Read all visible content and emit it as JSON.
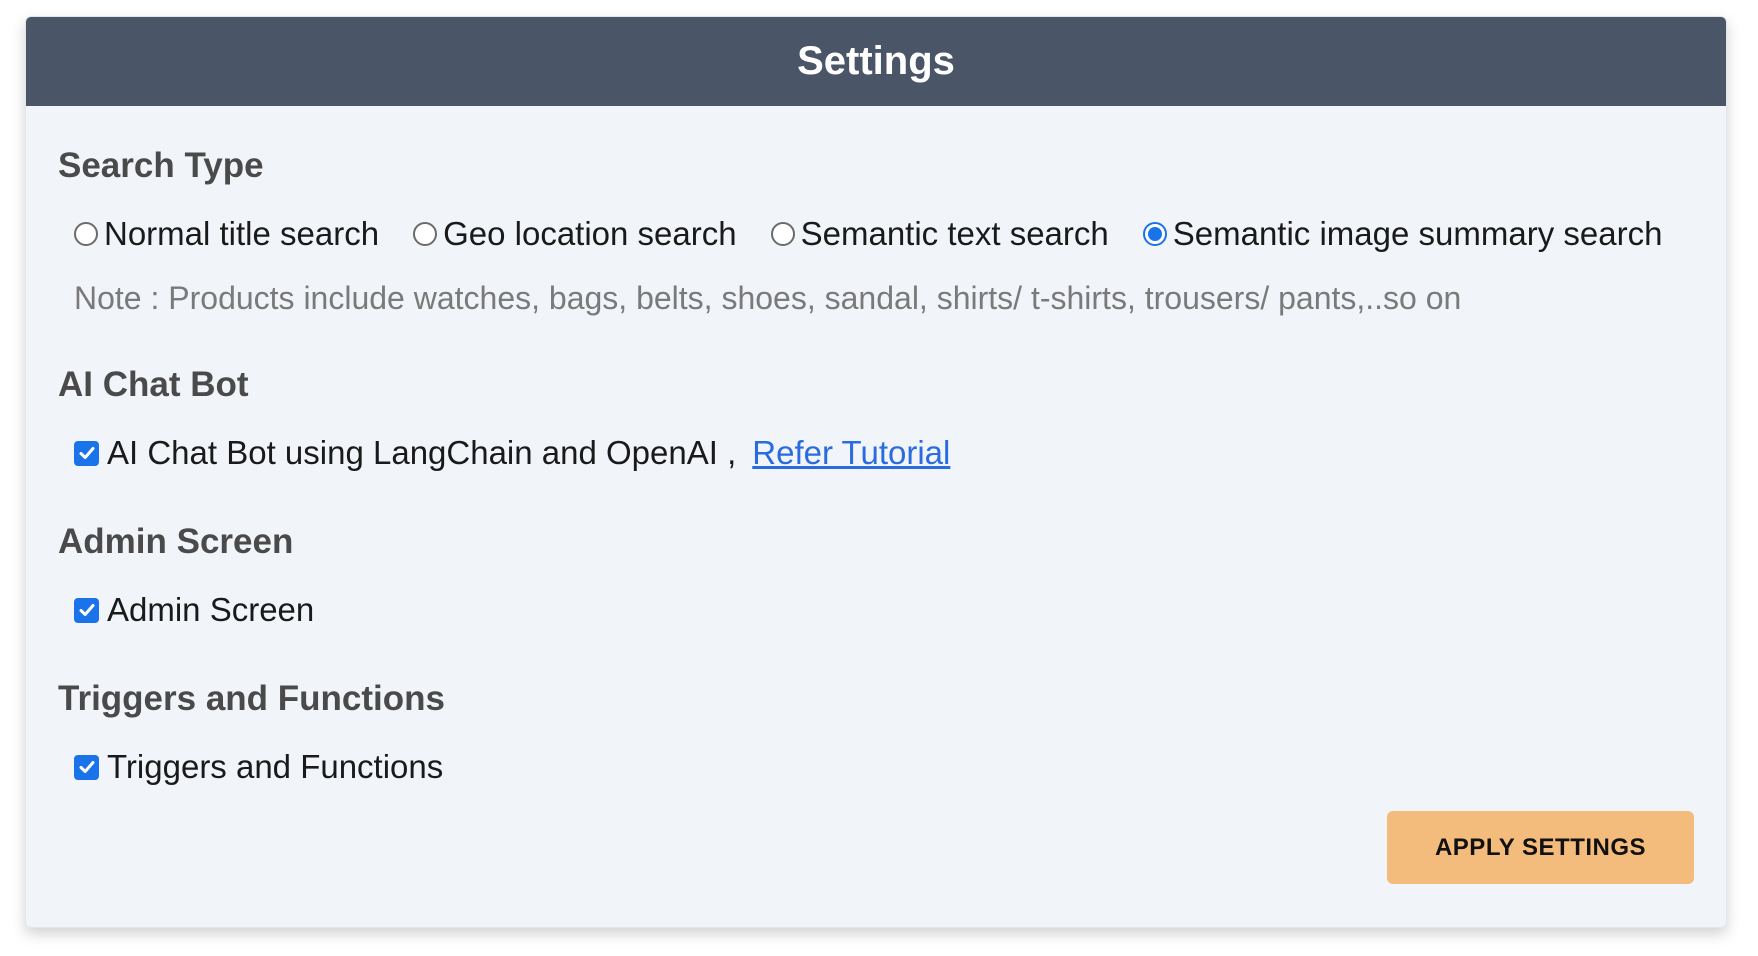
{
  "header": {
    "title": "Settings"
  },
  "search_type": {
    "title": "Search Type",
    "options": [
      {
        "label": "Normal title search",
        "checked": false
      },
      {
        "label": "Geo location search",
        "checked": false
      },
      {
        "label": "Semantic text search",
        "checked": false
      },
      {
        "label": "Semantic image summary search",
        "checked": true
      }
    ],
    "note": "Note : Products include watches, bags, belts, shoes, sandal, shirts/ t-shirts, trousers/ pants,..so on"
  },
  "chat_bot": {
    "title": "AI Chat Bot",
    "checkbox_label": "AI Chat Bot using LangChain and OpenAI ,",
    "checked": true,
    "link_text": "Refer Tutorial"
  },
  "admin_screen": {
    "title": "Admin Screen",
    "checkbox_label": "Admin Screen",
    "checked": true
  },
  "triggers": {
    "title": "Triggers and Functions",
    "checkbox_label": "Triggers and Functions",
    "checked": true
  },
  "apply_button": {
    "label": "APPLY SETTINGS"
  },
  "colors": {
    "header_bg": "#4a5568",
    "card_bg": "#f1f4f9",
    "accent": "#1a73e8",
    "link": "#2a6be0",
    "button_bg": "#f4bc7c"
  },
  "icons": {
    "checkbox_checked": "checkmark-icon"
  }
}
